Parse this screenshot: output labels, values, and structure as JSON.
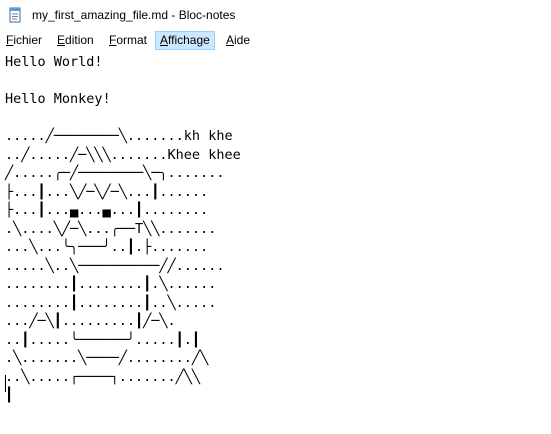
{
  "window": {
    "title": "my_first_amazing_file.md - Bloc-notes"
  },
  "menu": {
    "items": [
      {
        "first": "F",
        "rest": "ichier"
      },
      {
        "first": "E",
        "rest": "dition"
      },
      {
        "first": "F",
        "rest": "ormat"
      },
      {
        "first": "A",
        "rest": "ffichage"
      },
      {
        "first": "A",
        "rest": "ide"
      }
    ]
  },
  "editor": {
    "text": "Hello World!\n\nHello Monkey!\n\n.....╱────────╲.......kh khe\n..╱.....╱─╲╲╲.......Khee khee\n╱.....╭─╱────────╲─╮.......\n├...┃...╲╱─╲╱─╲...┃......\n├...┃...▄...▄...┃........\n.╲....╲╱─╲...╭──T╲╲.......\n...╲...╰╮───╯..┃.├.......\n.....╲..╲──────────╱╱......\n........┃........┃.╲......\n........┃........┃..╲.....\n...╱─╲┃.........┃╱─╲.\n..┃.....╰──────╯.....┃.┃\n.╲.......╲────╱........╱╲\n..╲.....┌────┐.......╱╲╲\n┃"
  }
}
